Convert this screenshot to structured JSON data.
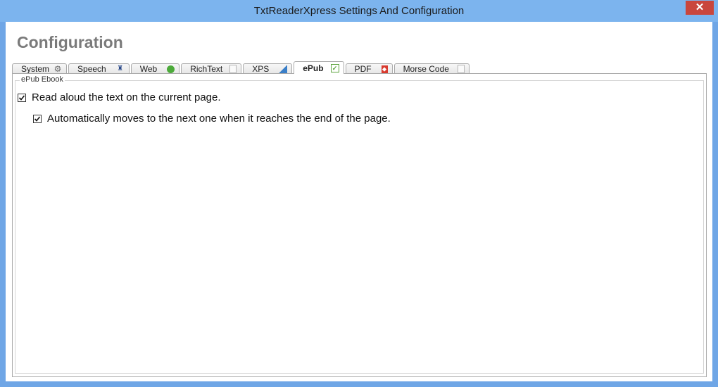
{
  "window": {
    "title": "TxtReaderXpress Settings And Configuration",
    "close_glyph": "✕"
  },
  "page": {
    "title": "Configuration"
  },
  "tabs": [
    {
      "label": "System",
      "icon": "gear-icon",
      "active": false
    },
    {
      "label": "Speech",
      "icon": "speech-icon",
      "active": false
    },
    {
      "label": "Web",
      "icon": "globe-icon",
      "active": false
    },
    {
      "label": "RichText",
      "icon": "document-icon",
      "active": false
    },
    {
      "label": "XPS",
      "icon": "xps-icon",
      "active": false
    },
    {
      "label": "ePub",
      "icon": "epub-icon",
      "active": true
    },
    {
      "label": "PDF",
      "icon": "pdf-icon",
      "active": false
    },
    {
      "label": "Morse Code",
      "icon": "document-icon",
      "active": false
    }
  ],
  "panel": {
    "group_label": "ePub Ebook",
    "options": [
      {
        "label": "Read aloud the text on the current page.",
        "checked": true
      },
      {
        "label": "Automatically moves to the next one when it reaches the end of the page.",
        "checked": true
      }
    ]
  },
  "colors": {
    "window_frame": "#6fa6e6",
    "close_button": "#c9463d",
    "title_text": "#7a7a7a"
  }
}
